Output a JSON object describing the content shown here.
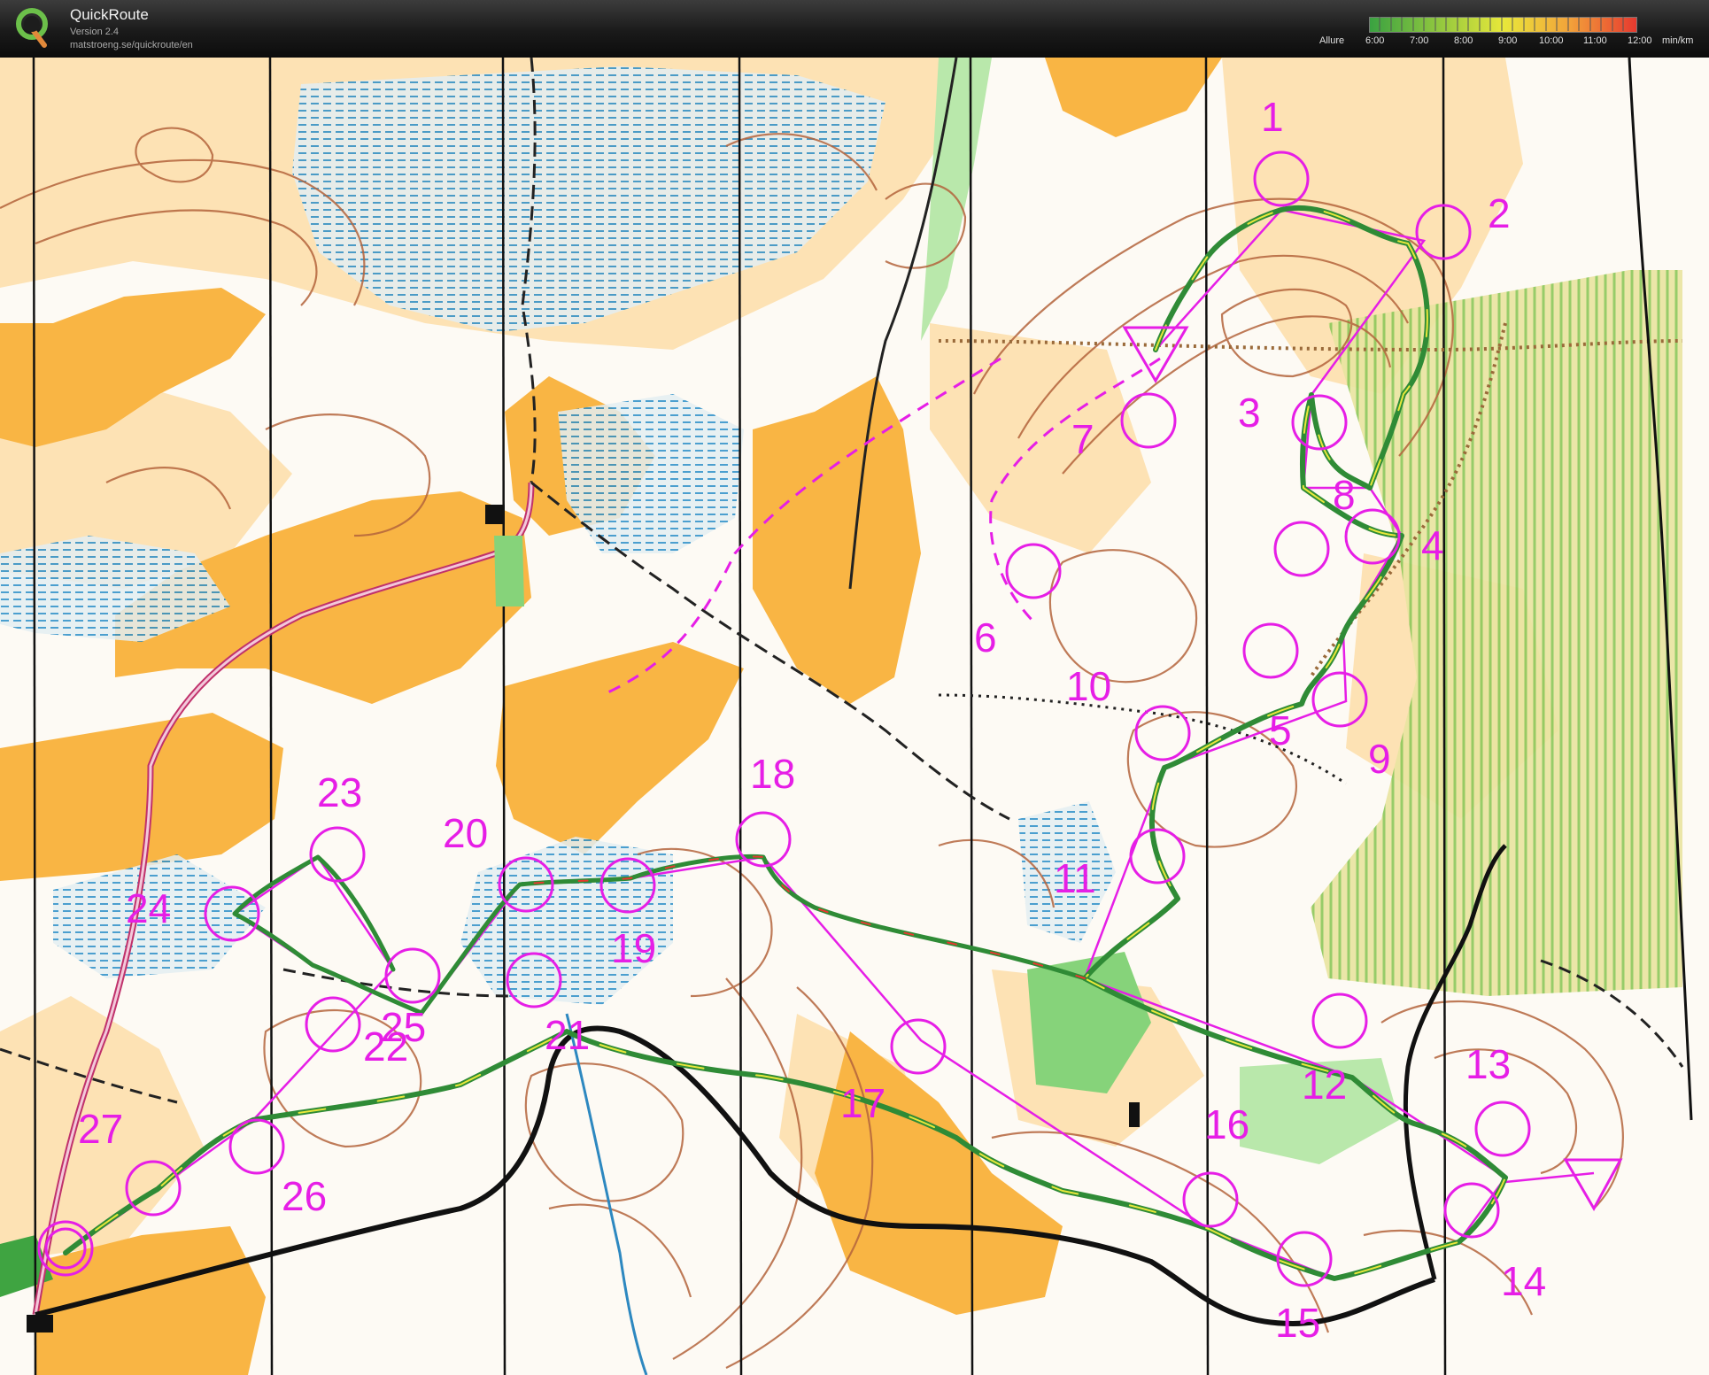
{
  "app": {
    "name": "QuickRoute",
    "version": "Version 2.4",
    "url": "matstroeng.se/quickroute/en"
  },
  "legend": {
    "title": "Allure",
    "ticks": [
      "6:00",
      "7:00",
      "8:00",
      "9:00",
      "10:00",
      "11:00",
      "12:00"
    ],
    "unit": "min/km",
    "colors": [
      "#3aa241",
      "#8ec63f",
      "#e8e83a",
      "#f3a23a",
      "#e6392f"
    ]
  },
  "map": {
    "colors": {
      "course": "#e61ee6",
      "open_land": "#f9b544",
      "rough_open": "#fde2b4",
      "contour": "#b4643c",
      "marsh": "#2c8fc9",
      "green": "#86d37a",
      "water": "#3fa0d8",
      "track_fast": "#2f8b36",
      "track_slow": "#e0392c"
    },
    "controls": [
      {
        "label": "1"
      },
      {
        "label": "2"
      },
      {
        "label": "3"
      },
      {
        "label": "4"
      },
      {
        "label": "5"
      },
      {
        "label": "6"
      },
      {
        "label": "7"
      },
      {
        "label": "8"
      },
      {
        "label": "9"
      },
      {
        "label": "10"
      },
      {
        "label": "11"
      },
      {
        "label": "12"
      },
      {
        "label": "13"
      },
      {
        "label": "14"
      },
      {
        "label": "15"
      },
      {
        "label": "16"
      },
      {
        "label": "17"
      },
      {
        "label": "18"
      },
      {
        "label": "19"
      },
      {
        "label": "20"
      },
      {
        "label": "21"
      },
      {
        "label": "22"
      },
      {
        "label": "23"
      },
      {
        "label": "24"
      },
      {
        "label": "25"
      },
      {
        "label": "26"
      },
      {
        "label": "27"
      },
      {
        "label": "20"
      }
    ]
  }
}
